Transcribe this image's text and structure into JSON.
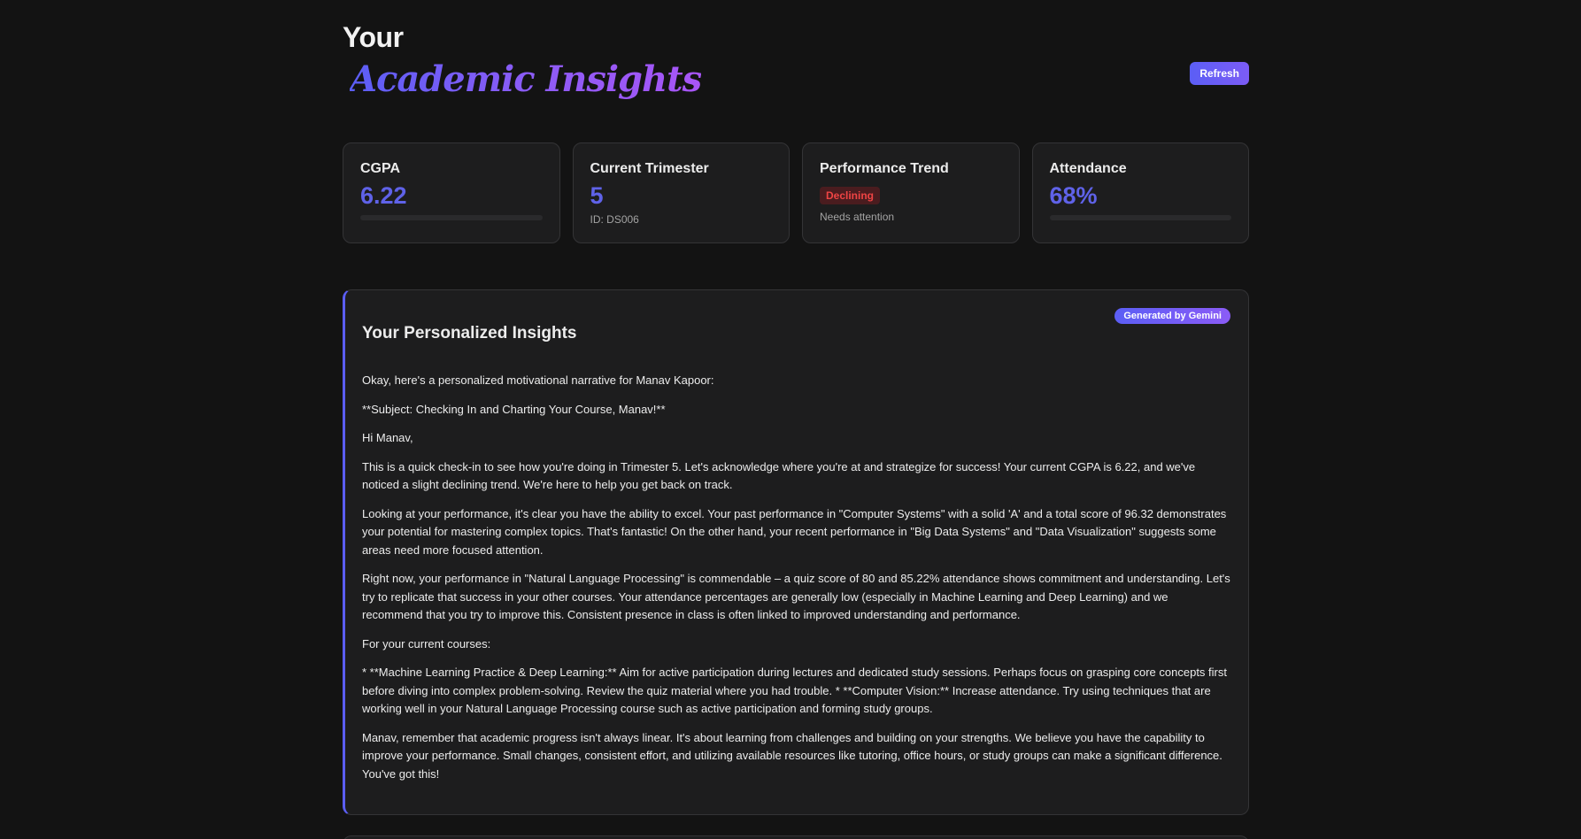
{
  "header": {
    "title_line1": "Your",
    "title_line2": "Academic Insights",
    "refresh_label": "Refresh"
  },
  "stats": {
    "cgpa": {
      "label": "CGPA",
      "value": "6.22",
      "progress_fraction": 0.0
    },
    "trimester": {
      "label": "Current Trimester",
      "value": "5",
      "sub": "ID: DS006"
    },
    "trend": {
      "label": "Performance Trend",
      "badge": "Declining",
      "sub": "Needs attention"
    },
    "attendance": {
      "label": "Attendance",
      "value": "68%",
      "progress_fraction": 0.0
    }
  },
  "insights": {
    "title": "Your Personalized Insights",
    "badge": "Generated by Gemini",
    "paragraphs": [
      "Okay, here's a personalized motivational narrative for Manav Kapoor:",
      "**Subject: Checking In and Charting Your Course, Manav!**",
      "Hi Manav,",
      "This is a quick check-in to see how you're doing in Trimester 5. Let's acknowledge where you're at and strategize for success! Your current CGPA is 6.22, and we've noticed a slight declining trend. We're here to help you get back on track.",
      "Looking at your performance, it's clear you have the ability to excel. Your past performance in \"Computer Systems\" with a solid 'A' and a total score of 96.32 demonstrates your potential for mastering complex topics. That's fantastic! On the other hand, your recent performance in \"Big Data Systems\" and \"Data Visualization\" suggests some areas need more focused attention.",
      "Right now, your performance in \"Natural Language Processing\" is commendable – a quiz score of 80 and 85.22% attendance shows commitment and understanding. Let's try to replicate that success in your other courses. Your attendance percentages are generally low (especially in Machine Learning and Deep Learning) and we recommend that you try to improve this. Consistent presence in class is often linked to improved understanding and performance.",
      "For your current courses:",
      "* **Machine Learning Practice & Deep Learning:** Aim for active participation during lectures and dedicated study sessions. Perhaps focus on grasping core concepts first before diving into complex problem-solving. Review the quiz material where you had trouble. * **Computer Vision:** Increase attendance. Try using techniques that are working well in your Natural Language Processing course such as active participation and forming study groups.",
      "Manav, remember that academic progress isn't always linear. It's about learning from challenges and building on your strengths. We believe you have the capability to improve your performance. Small changes, consistent effort, and utilizing available resources like tutoring, office hours, or study groups can make a significant difference. You've got this!"
    ]
  },
  "colors": {
    "accent": "#5b5ef5",
    "background": "#131313",
    "card": "#1d1d1e",
    "danger": "#ef4444"
  }
}
